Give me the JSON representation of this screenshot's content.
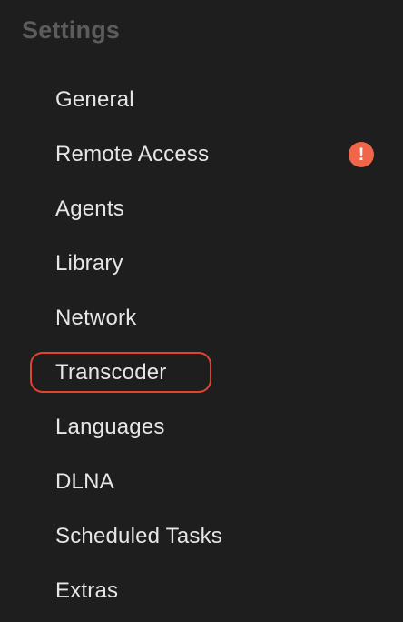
{
  "sidebar": {
    "title": "Settings",
    "items": [
      {
        "label": "General"
      },
      {
        "label": "Remote Access",
        "alert_icon": "exclamation-icon",
        "alert_text": "!"
      },
      {
        "label": "Agents"
      },
      {
        "label": "Library"
      },
      {
        "label": "Network"
      },
      {
        "label": "Transcoder",
        "highlighted": true
      },
      {
        "label": "Languages"
      },
      {
        "label": "DLNA"
      },
      {
        "label": "Scheduled Tasks"
      },
      {
        "label": "Extras"
      }
    ]
  },
  "colors": {
    "background": "#1e1e1e",
    "title": "#5c5c5c",
    "item_text": "#e6e6e6",
    "highlight_outline": "#e0452f",
    "alert": "#f0664b"
  }
}
